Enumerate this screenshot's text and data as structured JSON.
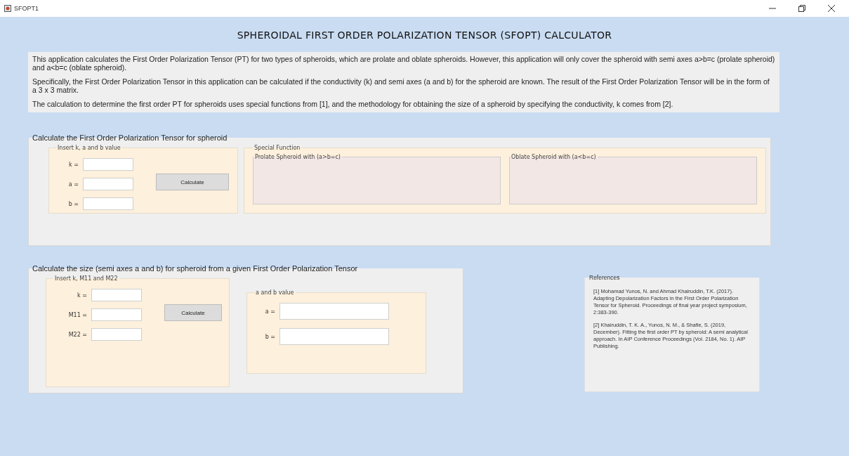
{
  "window": {
    "title": "SFOPT1"
  },
  "heading": "SPHEROIDAL FIRST ORDER POLARIZATION TENSOR (SFOPT) CALCULATOR",
  "intro": [
    "This application calculates the First Order Polarization Tensor (PT) for two types of spheroids, which are prolate and oblate spheroids. However, this application will only cover the spheroid with semi axes a>b=c (prolate spheroid) and a<b=c (oblate spheroid).",
    "Specifically, the First Order Polarization Tensor in this application can be calculated if the conductivity (k) and semi axes (a and b) for the spheroid are known. The result of the First Order Polarization Tensor will be in the form of a 3 x 3 matrix.",
    "The calculation to determine the first order PT for spheroids uses special functions from [1], and the methodology for obtaining the size of a spheroid by specifying the conductivity, k comes from [2]."
  ],
  "pt_panel": {
    "title": "Calculate the First Order Polarization Tensor for spheroid",
    "inputs": {
      "title": "Insert k, a and b value",
      "fields": [
        {
          "label": "k ="
        },
        {
          "label": "a ="
        },
        {
          "label": "b ="
        }
      ],
      "button": "Calculate"
    },
    "special_function": {
      "title": "Special Function",
      "boxes": [
        {
          "title": "Prolate Spheroid with (a>b=c)"
        },
        {
          "title": "Oblate Spheroid with (a<b=c)"
        }
      ]
    }
  },
  "size_panel": {
    "title": "Calculate the size (semi axes a and b) for spheroid from a given First Order Polarization Tensor",
    "inputs": {
      "title": "Insert k, M11 and M22",
      "fields": [
        {
          "label": "k ="
        },
        {
          "label": "M11 ="
        },
        {
          "label": "M22 ="
        }
      ],
      "button": "Calculate"
    },
    "results": {
      "title": "a and b value",
      "fields": [
        {
          "label": "a ="
        },
        {
          "label": "b ="
        }
      ]
    }
  },
  "references": {
    "title": "References",
    "items": [
      "[1] Mohamad Yunos, N. and Ahmad Khairuddin, T.K. (2017). Adapting Depolarization Factors in the First Order Polarization Tensor for Spheroid. Proceedings of final year project symposium, 2:383-390.",
      "[2] Khairuddin, T. K. A., Yunos, N. M., & Shafie, S. (2019, December). Fitting the first order PT by spheroid: A semi analytical approach. In AIP Conference Proceedings (Vol. 2184, No. 1). AIP Publishing."
    ]
  }
}
